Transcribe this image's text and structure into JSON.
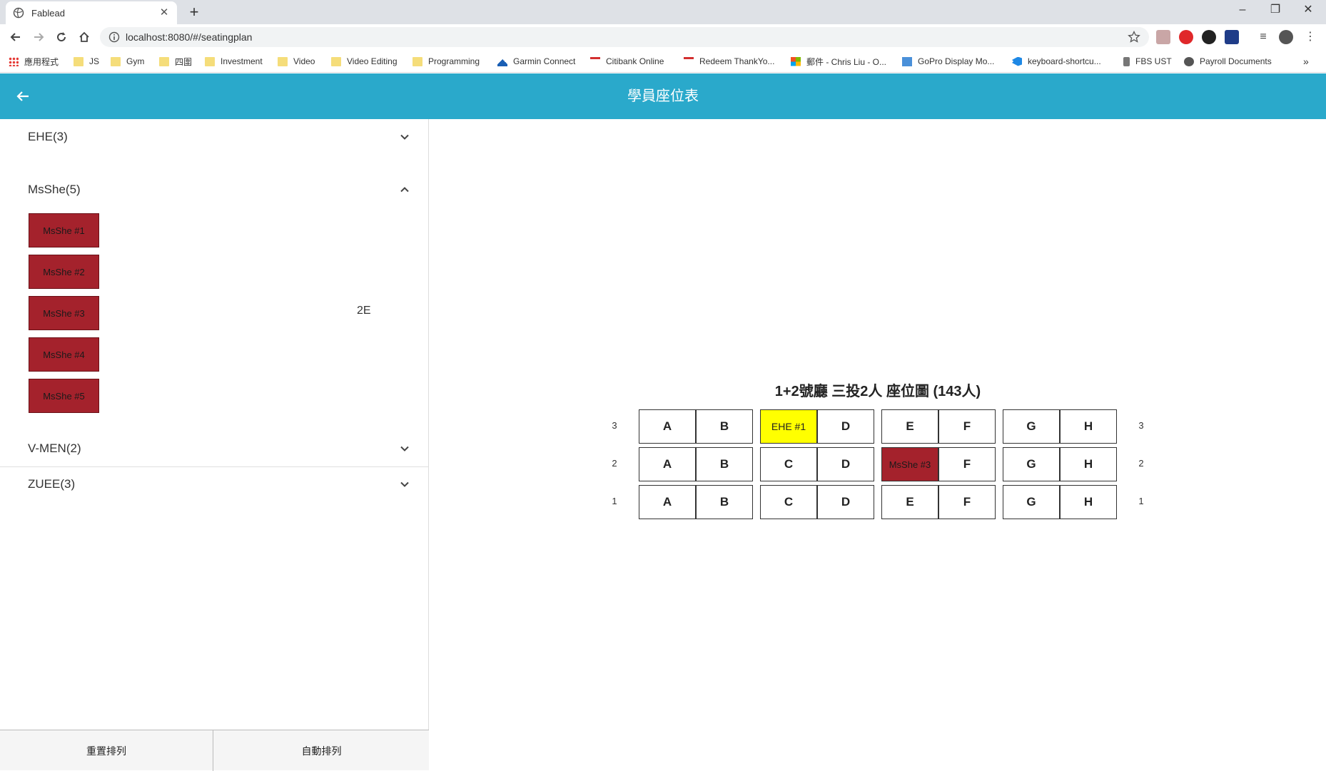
{
  "browser": {
    "tab_title": "Fablead",
    "url": "localhost:8080/#/seatingplan",
    "bookmarks": [
      {
        "label": "應用程式",
        "icon": "apps-grid-icon"
      },
      {
        "label": "JS",
        "icon": "folder-icon"
      },
      {
        "label": "Gym",
        "icon": "folder-icon"
      },
      {
        "label": "四圍",
        "icon": "folder-icon"
      },
      {
        "label": "Investment",
        "icon": "folder-icon"
      },
      {
        "label": "Video",
        "icon": "folder-icon"
      },
      {
        "label": "Video Editing",
        "icon": "folder-icon"
      },
      {
        "label": "Programming",
        "icon": "folder-icon"
      },
      {
        "label": "Garmin Connect",
        "icon": "garmin-icon"
      },
      {
        "label": "Citibank Online",
        "icon": "citi-icon"
      },
      {
        "label": "Redeem ThankYo...",
        "icon": "citi-icon"
      },
      {
        "label": "郵件 - Chris Liu - O...",
        "icon": "microsoft-icon"
      },
      {
        "label": "GoPro Display Mo...",
        "icon": "gopro-icon"
      },
      {
        "label": "keyboard-shortcu...",
        "icon": "vscode-icon"
      },
      {
        "label": "FBS UST",
        "icon": "fbs-icon"
      },
      {
        "label": "Payroll Documents",
        "icon": "globe-icon"
      }
    ],
    "more_bookmarks": "»"
  },
  "app": {
    "title": "學員座位表"
  },
  "groups": [
    {
      "name": "EHE(3)",
      "expanded": false
    },
    {
      "name": "MsShe(5)",
      "expanded": true,
      "students": [
        "MsShe #1",
        "MsShe #2",
        "MsShe #3",
        "MsShe #4",
        "MsShe #5"
      ]
    },
    {
      "name": "V-MEN(2)",
      "expanded": false
    },
    {
      "name": "ZUEE(3)",
      "expanded": false
    }
  ],
  "selected_seat_hint": "2E",
  "actions": {
    "reset": "重置排列",
    "auto": "自動排列"
  },
  "plan": {
    "title": "1+2號廳 三投2人 座位圖 (143人)",
    "rows": [
      {
        "label": "3",
        "seats": [
          "A",
          "B",
          "EHE #1",
          "D",
          "E",
          "F",
          "G",
          "H"
        ]
      },
      {
        "label": "2",
        "seats": [
          "A",
          "B",
          "C",
          "D",
          "MsShe #3",
          "F",
          "G",
          "H"
        ]
      },
      {
        "label": "1",
        "seats": [
          "A",
          "B",
          "C",
          "D",
          "E",
          "F",
          "G",
          "H"
        ]
      }
    ],
    "occupied_colors": {
      "EHE": "#ffff00",
      "MsShe": "#a4222c"
    },
    "accent_color": "#2aa9cb"
  }
}
